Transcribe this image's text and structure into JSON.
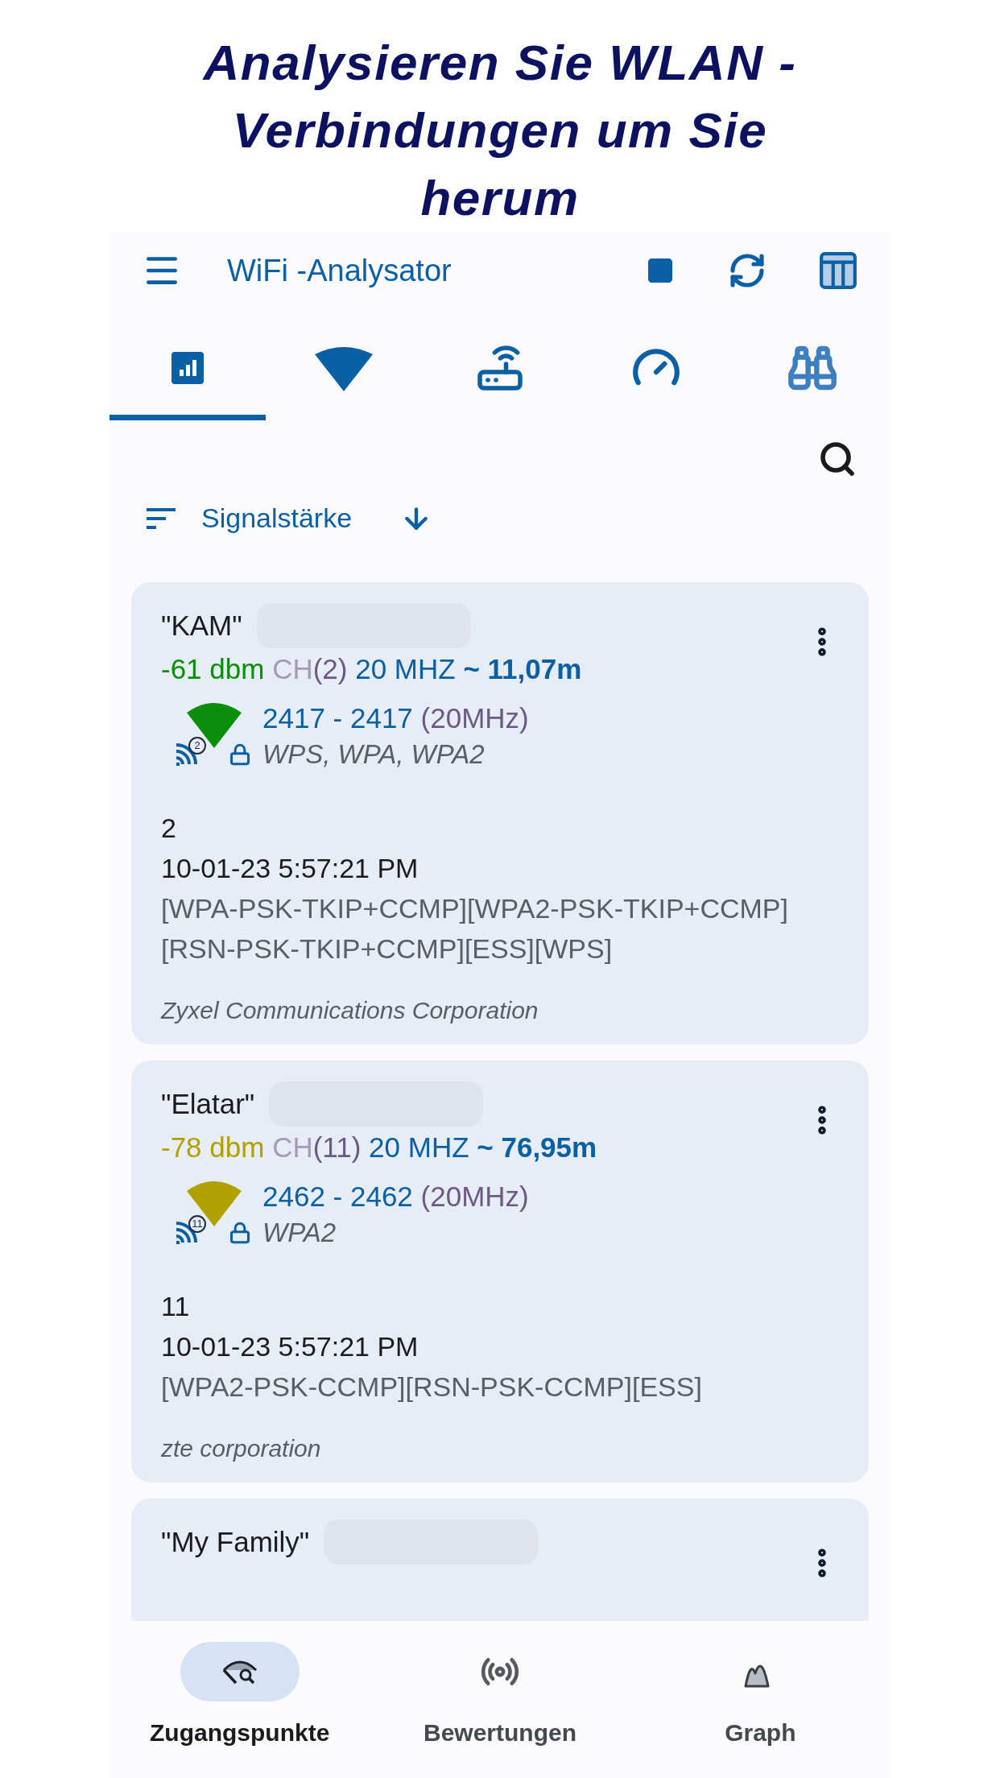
{
  "headline": "Analysieren Sie WLAN -Verbindungen um Sie herum",
  "app_bar": {
    "title": "WiFi -Analysator"
  },
  "tabs": [
    {
      "selected": true
    },
    {
      "selected": false
    },
    {
      "selected": false
    },
    {
      "selected": false
    },
    {
      "selected": false
    }
  ],
  "sort": {
    "label": "Signalstärke"
  },
  "networks": [
    {
      "ssid": "\"KAM\"",
      "signal": "-61 dbm",
      "color": "#0b8f0b",
      "channel_label": "CH",
      "channel": "(2)",
      "width": "20 MHZ",
      "distance": "~ 11,07m",
      "frequency": "2417 - 2417",
      "bandwidth": "(20MHz)",
      "channel_badge": "2",
      "security": "WPS, WPA, WPA2",
      "channel_number": "2",
      "time": "10-01-23 5:57:21 PM",
      "capabilities": [
        "[WPA-PSK-TKIP+CCMP][WPA2-PSK-TKIP+CCMP]",
        "[RSN-PSK-TKIP+CCMP][ESS][WPS]"
      ],
      "vendor": "Zyxel Communications Corporation"
    },
    {
      "ssid": "\"Elatar\"",
      "signal": "-78 dbm",
      "color": "#b0a000",
      "channel_label": "CH",
      "channel": "(11)",
      "width": "20 MHZ",
      "distance": "~ 76,95m",
      "frequency": "2462 - 2462",
      "bandwidth": "(20MHz)",
      "channel_badge": "11",
      "security": "WPA2",
      "channel_number": "11",
      "time": "10-01-23 5:57:21 PM",
      "capabilities": [
        "[WPA2-PSK-CCMP][RSN-PSK-CCMP][ESS]"
      ],
      "vendor": "zte corporation"
    },
    {
      "ssid": "\"My Family\""
    }
  ],
  "bottom_nav": [
    {
      "label": "Zugangspunkte",
      "selected": true
    },
    {
      "label": "Bewertungen",
      "selected": false
    },
    {
      "label": "Graph",
      "selected": false
    }
  ]
}
